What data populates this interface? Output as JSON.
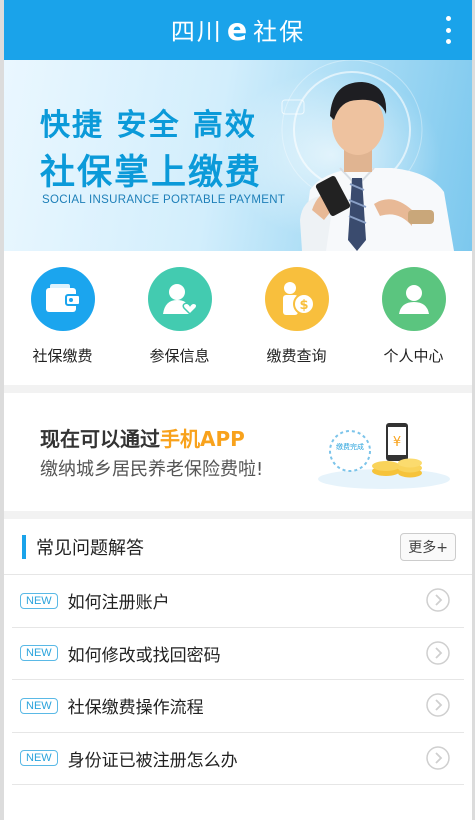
{
  "header": {
    "title_prefix": "四川",
    "title_e": "e",
    "title_suffix": "社保"
  },
  "banner": {
    "line1": "快捷 安全 高效",
    "line2": "社保掌上缴费",
    "line3": "SOCIAL INSURANCE PORTABLE PAYMENT"
  },
  "shortcuts": [
    {
      "label": "社保缴费",
      "icon": "wallet-icon",
      "color": "#1ba5ee"
    },
    {
      "label": "参保信息",
      "icon": "user-heart-icon",
      "color": "#43cbb0"
    },
    {
      "label": "缴费查询",
      "icon": "user-coin-icon",
      "color": "#f8bf3d"
    },
    {
      "label": "个人中心",
      "icon": "person-icon",
      "color": "#5bc57f"
    }
  ],
  "promo": {
    "line1_prefix": "现在可以通过",
    "line1_highlight": "手机APP",
    "line2": "缴纳城乡居民养老保险费啦!",
    "badge": "缴费完成"
  },
  "faq": {
    "title": "常见问题解答",
    "more": "更多+",
    "items": [
      {
        "tag": "NEW",
        "text": "如何注册账户"
      },
      {
        "tag": "NEW",
        "text": "如何修改或找回密码"
      },
      {
        "tag": "NEW",
        "text": "社保缴费操作流程"
      },
      {
        "tag": "NEW",
        "text": "身份证已被注册怎么办"
      }
    ]
  },
  "colors": {
    "primary": "#1aa3ea",
    "highlight": "#f8a21c"
  }
}
